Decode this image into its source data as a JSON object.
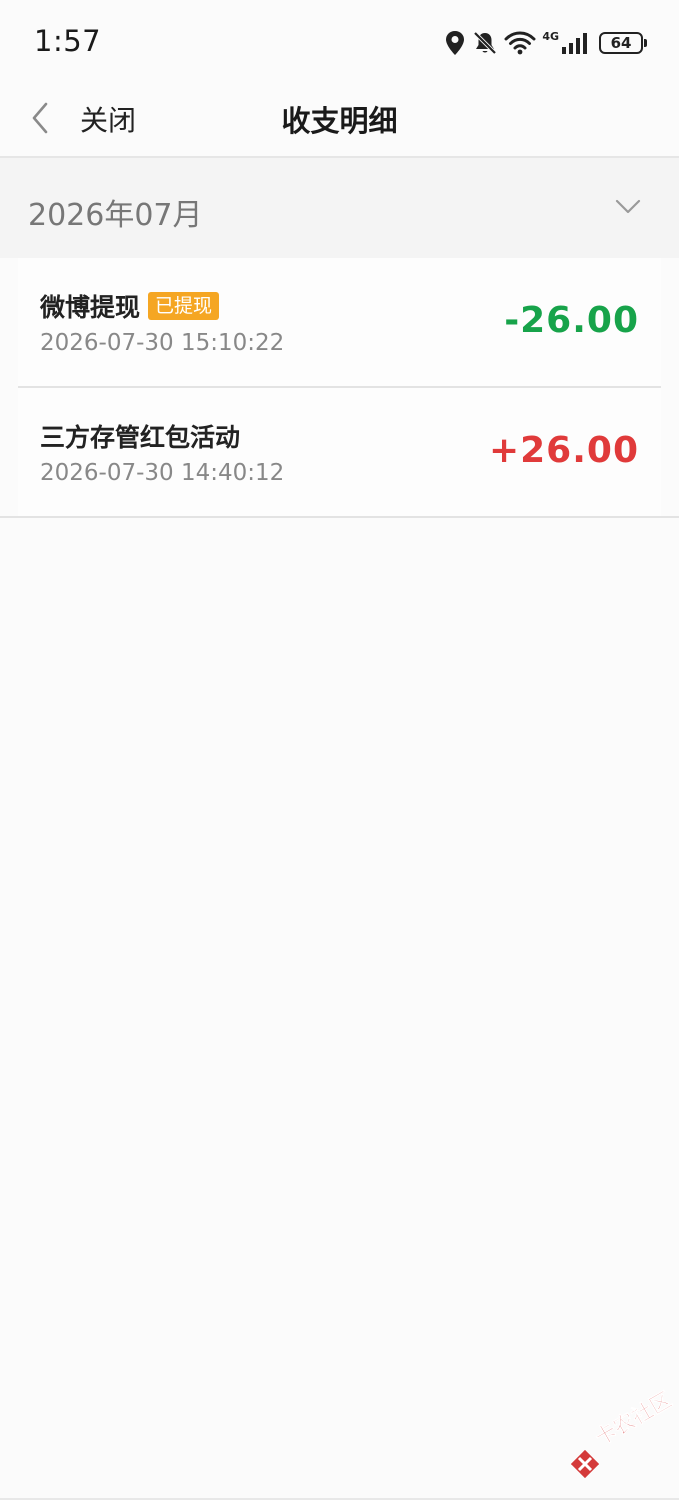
{
  "status_bar": {
    "time": "1:57",
    "network_label": "4G",
    "battery": "64"
  },
  "nav": {
    "close_label": "关闭",
    "title": "收支明细"
  },
  "month_filter": {
    "label": "2026年07月"
  },
  "records": [
    {
      "title": "微博提现",
      "badge": "已提现",
      "time": "2026-07-30 15:10:22",
      "amount": "-26.00"
    },
    {
      "title": "三方存管红包活动",
      "badge": "",
      "time": "2026-07-30 14:40:12",
      "amount": "+26.00"
    }
  ],
  "colors": {
    "expense": "#17a34a",
    "income": "#e03a3a",
    "badge_bg": "#f5a623"
  },
  "watermark": {
    "text": "卡农社区"
  }
}
